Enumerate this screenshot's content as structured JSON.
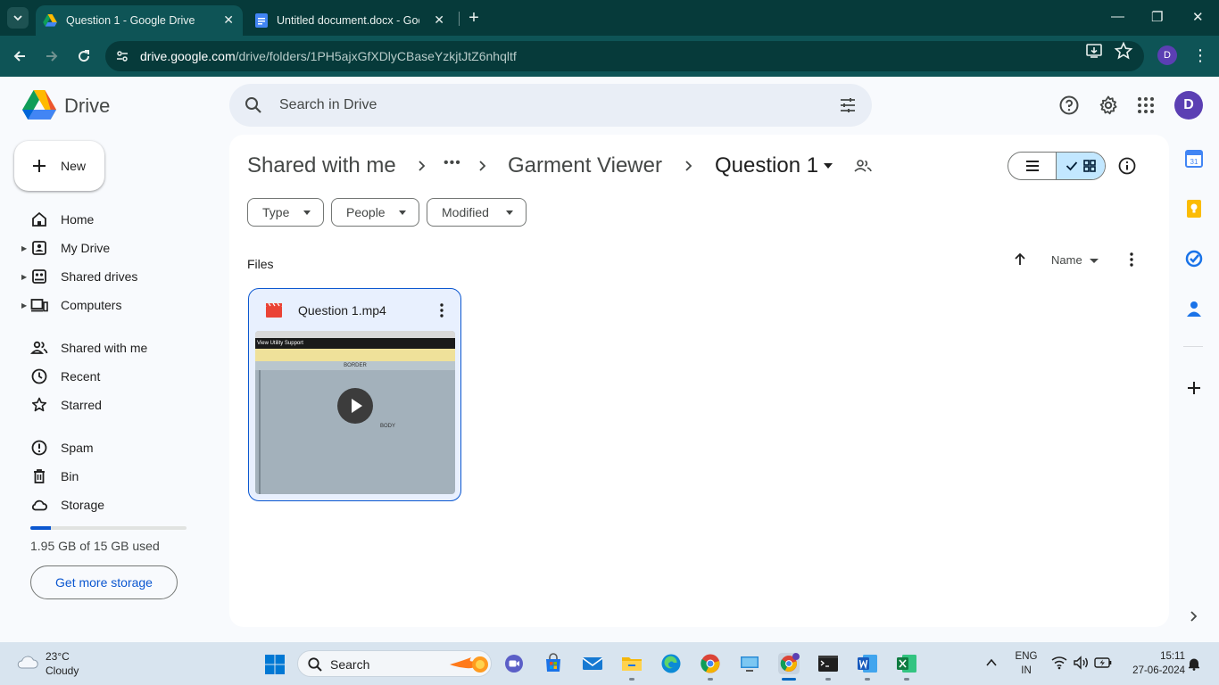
{
  "browser": {
    "tabs": [
      {
        "title": "Question 1 - Google Drive",
        "icon": "google-drive-icon",
        "active": true
      },
      {
        "title": "Untitled document.docx - Goog",
        "icon": "google-docs-icon",
        "active": false
      }
    ],
    "url_host": "drive.google.com",
    "url_path": "/drive/folders/1PH5ajxGfXDlyCBaseYzkjtJtZ6nhqltf",
    "profile_initial": "D"
  },
  "header": {
    "app_name": "Drive",
    "search_placeholder": "Search in Drive",
    "avatar_initial": "D"
  },
  "sidebar": {
    "new_label": "New",
    "items": [
      {
        "label": "Home",
        "icon": "home-icon",
        "expandable": false
      },
      {
        "label": "My Drive",
        "icon": "my-drive-icon",
        "expandable": true
      },
      {
        "label": "Shared drives",
        "icon": "shared-drives-icon",
        "expandable": true
      },
      {
        "label": "Computers",
        "icon": "computers-icon",
        "expandable": true
      },
      {
        "label": "Shared with me",
        "icon": "shared-with-me-icon",
        "expandable": false
      },
      {
        "label": "Recent",
        "icon": "clock-icon",
        "expandable": false
      },
      {
        "label": "Starred",
        "icon": "star-icon",
        "expandable": false
      },
      {
        "label": "Spam",
        "icon": "spam-icon",
        "expandable": false
      },
      {
        "label": "Bin",
        "icon": "trash-icon",
        "expandable": false
      },
      {
        "label": "Storage",
        "icon": "cloud-icon",
        "expandable": false
      }
    ],
    "storage_used_fraction": 0.13,
    "storage_text": "1.95 GB of 15 GB used",
    "get_more_storage": "Get more storage"
  },
  "breadcrumb": {
    "root": "Shared with me",
    "ellipsis": "•••",
    "parent": "Garment Viewer",
    "current": "Question 1"
  },
  "filters": {
    "type": "Type",
    "people": "People",
    "modified": "Modified"
  },
  "files_section": {
    "label": "Files",
    "sort_label": "Name"
  },
  "files": [
    {
      "name": "Question 1.mp4",
      "icon": "video-file-icon",
      "thumb_menu": "View   Utility   Support",
      "thumb_border": "BORDER",
      "thumb_body": "BODY"
    }
  ],
  "taskbar": {
    "weather_temp": "23°C",
    "weather_desc": "Cloudy",
    "search_label": "Search",
    "lang_line1": "ENG",
    "lang_line2": "IN",
    "time": "15:11",
    "date": "27-06-2024"
  },
  "colors": {
    "accent": "#0b57d0",
    "browser_dark": "#063a3a",
    "browser_mid": "#0e5456",
    "selected_bg": "#c2e7ff",
    "avatar": "#5b3fb3"
  }
}
